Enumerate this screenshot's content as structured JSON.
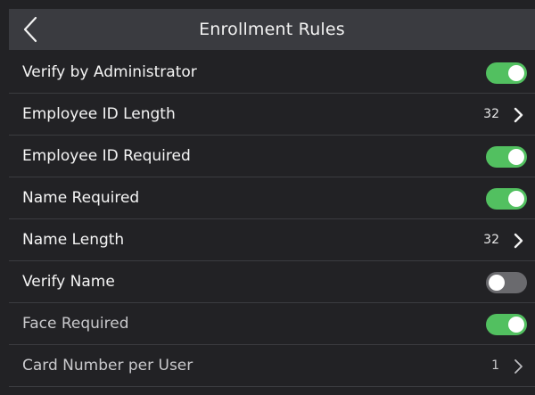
{
  "header": {
    "title": "Enrollment Rules",
    "back_icon": "chevron-left-icon"
  },
  "rows": [
    {
      "label": "Verify by Administrator",
      "type": "toggle",
      "state": "on"
    },
    {
      "label": "Employee ID Length",
      "type": "link",
      "value": "32",
      "icon": "chevron-right-icon"
    },
    {
      "label": "Employee ID Required",
      "type": "toggle",
      "state": "on"
    },
    {
      "label": "Name Required",
      "type": "toggle",
      "state": "on"
    },
    {
      "label": "Name Length",
      "type": "link",
      "value": "32",
      "icon": "chevron-right-icon"
    },
    {
      "label": "Verify Name",
      "type": "toggle",
      "state": "off"
    },
    {
      "label": "Face Required",
      "type": "toggle",
      "state": "on"
    },
    {
      "label": "Card Number per User",
      "type": "link",
      "value": "1",
      "icon": "chevron-right-icon"
    }
  ],
  "colors": {
    "toggle_on": "#52c060",
    "toggle_off": "#6a6a6e",
    "header_bg": "#3a3b40",
    "list_bg": "#222225"
  }
}
